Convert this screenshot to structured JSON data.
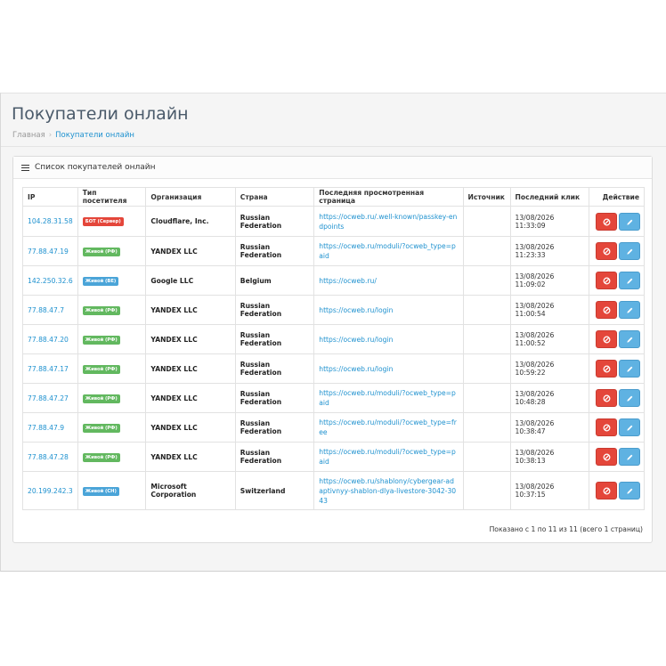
{
  "page": {
    "title": "Покупатели онлайн",
    "breadcrumb": [
      "Главная",
      "Покупатели онлайн"
    ]
  },
  "panel": {
    "heading": "Список покупателей онлайн",
    "icon": "list-icon"
  },
  "table": {
    "columns": [
      "IP",
      "Тип посетителя",
      "Организация",
      "Страна",
      "Последняя просмотренная страница",
      "Источник",
      "Последний клик",
      "Действие"
    ],
    "rows": [
      {
        "ip": "104.28.31.58",
        "type": "БОТ (Сервер)",
        "type_color": "#e4463a",
        "org": "Cloudflare, Inc.",
        "country": "Russian Federation",
        "url": "https://ocweb.ru/.well-known/passkey-endpoints",
        "source": "",
        "time": "13/08/2026 11:33:09"
      },
      {
        "ip": "77.88.47.19",
        "type": "Живой (РФ)",
        "type_color": "#62b85f",
        "org": "YANDEX LLC",
        "country": "Russian Federation",
        "url": "https://ocweb.ru/moduli/?ocweb_type=paid",
        "source": "",
        "time": "13/08/2026 11:23:33"
      },
      {
        "ip": "142.250.32.6",
        "type": "Живой (BE)",
        "type_color": "#4aa4d8",
        "org": "Google LLC",
        "country": "Belgium",
        "url": "https://ocweb.ru/",
        "source": "",
        "time": "13/08/2026 11:09:02"
      },
      {
        "ip": "77.88.47.7",
        "type": "Живой (РФ)",
        "type_color": "#62b85f",
        "org": "YANDEX LLC",
        "country": "Russian Federation",
        "url": "https://ocweb.ru/login",
        "source": "",
        "time": "13/08/2026 11:00:54"
      },
      {
        "ip": "77.88.47.20",
        "type": "Живой (РФ)",
        "type_color": "#62b85f",
        "org": "YANDEX LLC",
        "country": "Russian Federation",
        "url": "https://ocweb.ru/login",
        "source": "",
        "time": "13/08/2026 11:00:52"
      },
      {
        "ip": "77.88.47.17",
        "type": "Живой (РФ)",
        "type_color": "#62b85f",
        "org": "YANDEX LLC",
        "country": "Russian Federation",
        "url": "https://ocweb.ru/login",
        "source": "",
        "time": "13/08/2026 10:59:22"
      },
      {
        "ip": "77.88.47.27",
        "type": "Живой (РФ)",
        "type_color": "#62b85f",
        "org": "YANDEX LLC",
        "country": "Russian Federation",
        "url": "https://ocweb.ru/moduli/?ocweb_type=paid",
        "source": "",
        "time": "13/08/2026 10:48:28"
      },
      {
        "ip": "77.88.47.9",
        "type": "Живой (РФ)",
        "type_color": "#62b85f",
        "org": "YANDEX LLC",
        "country": "Russian Federation",
        "url": "https://ocweb.ru/moduli/?ocweb_type=free",
        "source": "",
        "time": "13/08/2026 10:38:47"
      },
      {
        "ip": "77.88.47.28",
        "type": "Живой (РФ)",
        "type_color": "#62b85f",
        "org": "YANDEX LLC",
        "country": "Russian Federation",
        "url": "https://ocweb.ru/moduli/?ocweb_type=paid",
        "source": "",
        "time": "13/08/2026 10:38:13"
      },
      {
        "ip": "20.199.242.3",
        "type": "Живой (CH)",
        "type_color": "#4aa4d8",
        "org": "Microsoft Corporation",
        "country": "Switzerland",
        "url": "https://ocweb.ru/shablony/cybergear-adaptivnyy-shablon-dlya-livestore-3042-3043",
        "source": "",
        "time": "13/08/2026 10:37:15"
      }
    ],
    "actions": {
      "delete_icon": "ban-icon",
      "edit_icon": "pencil-icon",
      "delete_color": "#e4463a",
      "edit_color": "#5fb2e2"
    }
  },
  "pagination": {
    "summary": "Показано с 1 по 11 из 11 (всего 1 страниц)"
  }
}
